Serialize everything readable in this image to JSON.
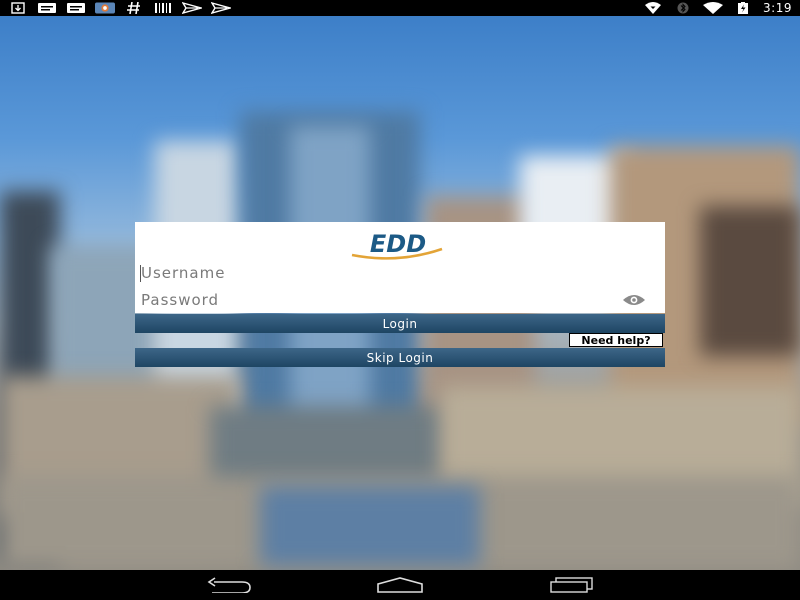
{
  "status_bar": {
    "left_icons": [
      "download-icon",
      "message-icon",
      "message-icon",
      "app-icon",
      "hash-icon",
      "barcode-icon",
      "send-icon",
      "send-icon"
    ],
    "right_icons": [
      "signal-icon",
      "bluetooth-icon",
      "wifi-icon",
      "battery-charging-icon"
    ],
    "time": "3:19"
  },
  "login": {
    "logo_text": "EDD",
    "username_placeholder": "Username",
    "password_placeholder": "Password",
    "login_label": "Login",
    "help_label": "Need help?",
    "skip_label": "Skip Login"
  },
  "colors": {
    "button": "#2a5273",
    "logo_blue": "#1c5a86",
    "logo_gold": "#e3a437"
  },
  "nav_bar": {
    "items": [
      "back-icon",
      "home-icon",
      "recents-icon"
    ]
  }
}
